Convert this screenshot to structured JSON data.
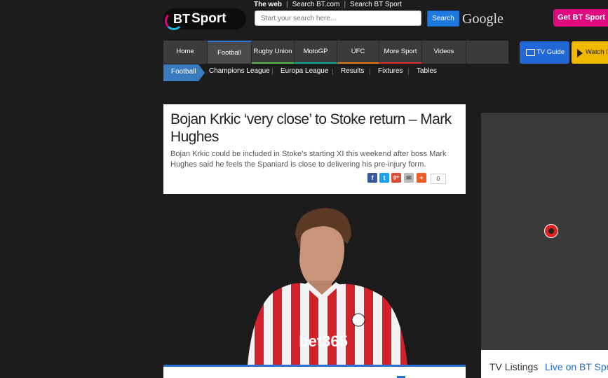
{
  "header": {
    "logo_bt": "BT",
    "logo_sport": "Sport",
    "search_links": [
      "The web",
      "Search BT.com",
      "Search BT Sport"
    ],
    "search_placeholder": "Start your search here...",
    "search_button": "Search",
    "google_label": "Google",
    "get_bt_sport": "Get BT Sport"
  },
  "nav": {
    "items": [
      {
        "label": "Home",
        "accent": "#3b3b3b"
      },
      {
        "label": "Football",
        "accent": "#2a6fd1"
      },
      {
        "label": "Rugby Union",
        "accent": "#5cb84a"
      },
      {
        "label": "MotoGP",
        "accent": "#14a89b"
      },
      {
        "label": "UFC",
        "accent": "#e07d14"
      },
      {
        "label": "More Sport",
        "accent": "#d62f2f"
      },
      {
        "label": "Videos",
        "accent": "#3b3b3b"
      }
    ],
    "tv_guide": "TV Guide",
    "watch": "Watch li"
  },
  "subnav": {
    "active": "Football",
    "items": [
      "Champions League",
      "Europa League",
      "Results",
      "Fixtures",
      "Tables"
    ]
  },
  "article": {
    "headline": "Bojan Krkic ‘very close’ to Stoke return – Mark Hughes",
    "standfirst": "Bojan Krkic could be included in Stoke’s starting XI this weekend after boss Mark Hughes said he feels the Spaniard is close to delivering his pre-injury form.",
    "share_count": "0",
    "share_icons": [
      "facebook-icon",
      "twitter-icon",
      "google-plus-icon",
      "email-icon",
      "addthis-icon"
    ],
    "photo_sponsor": "bet365"
  },
  "sidebar": {
    "tv_listings": "TV Listings",
    "live_on": "Live on BT Sport"
  },
  "colors": {
    "brand_pink": "#e0087e",
    "football_blue": "#3a7bbf",
    "search_blue": "#1f7adf",
    "tvguide_blue": "#2168d4",
    "watch_yellow": "#f0b800"
  }
}
